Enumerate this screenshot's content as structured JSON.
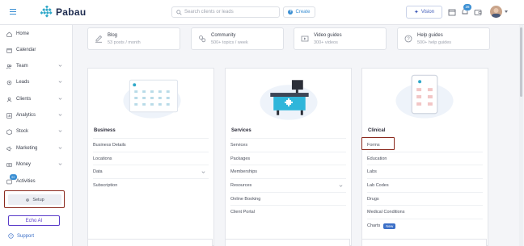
{
  "header": {
    "brand": "Pabau",
    "search_placeholder": "Search clients or leads",
    "create_label": "Create",
    "vision_label": "Vision",
    "notification_count": "28"
  },
  "sidebar": {
    "items": [
      {
        "label": "Home",
        "icon": "home-icon",
        "has_chevron": false
      },
      {
        "label": "Calendar",
        "icon": "calendar-icon",
        "has_chevron": false
      },
      {
        "label": "Team",
        "icon": "team-icon",
        "has_chevron": true
      },
      {
        "label": "Leads",
        "icon": "leads-icon",
        "has_chevron": true
      },
      {
        "label": "Clients",
        "icon": "clients-icon",
        "has_chevron": true
      },
      {
        "label": "Analytics",
        "icon": "analytics-icon",
        "has_chevron": true
      },
      {
        "label": "Stock",
        "icon": "stock-icon",
        "has_chevron": true
      },
      {
        "label": "Marketing",
        "icon": "marketing-icon",
        "has_chevron": true
      },
      {
        "label": "Money",
        "icon": "money-icon",
        "has_chevron": true
      },
      {
        "label": "Activities",
        "icon": "activities-icon",
        "has_chevron": false
      }
    ],
    "activities_badge": "9+",
    "setup_label": "Setup",
    "echo_label": "Echo AI",
    "support_label": "Support"
  },
  "resources": [
    {
      "title": "Blog",
      "sub": "53 posts / month",
      "icon": "blog-icon"
    },
    {
      "title": "Community",
      "sub": "500+ topics / week",
      "icon": "community-icon"
    },
    {
      "title": "Video guides",
      "sub": "300+ videos",
      "icon": "video-icon"
    },
    {
      "title": "Help guides",
      "sub": "500+ help guides",
      "icon": "help-icon"
    }
  ],
  "panels": {
    "business": {
      "title": "Business",
      "rows": [
        "Business Details",
        "Locations",
        "Data",
        "Subscription"
      ]
    },
    "services": {
      "title": "Services",
      "rows": [
        "Services",
        "Packages",
        "Memberships",
        "Resources",
        "Online Booking",
        "Client Portal"
      ]
    },
    "clinical": {
      "title": "Clinical",
      "rows": [
        "Forms",
        "Education",
        "Labs",
        "Lab Codes",
        "Drugs",
        "Medical Conditions",
        "Charts"
      ],
      "new_tag": "New"
    }
  },
  "colors": {
    "brand_blue": "#3b8fd3",
    "highlight_red": "#8b2a1e",
    "echo_purple": "#5a3cc9"
  }
}
